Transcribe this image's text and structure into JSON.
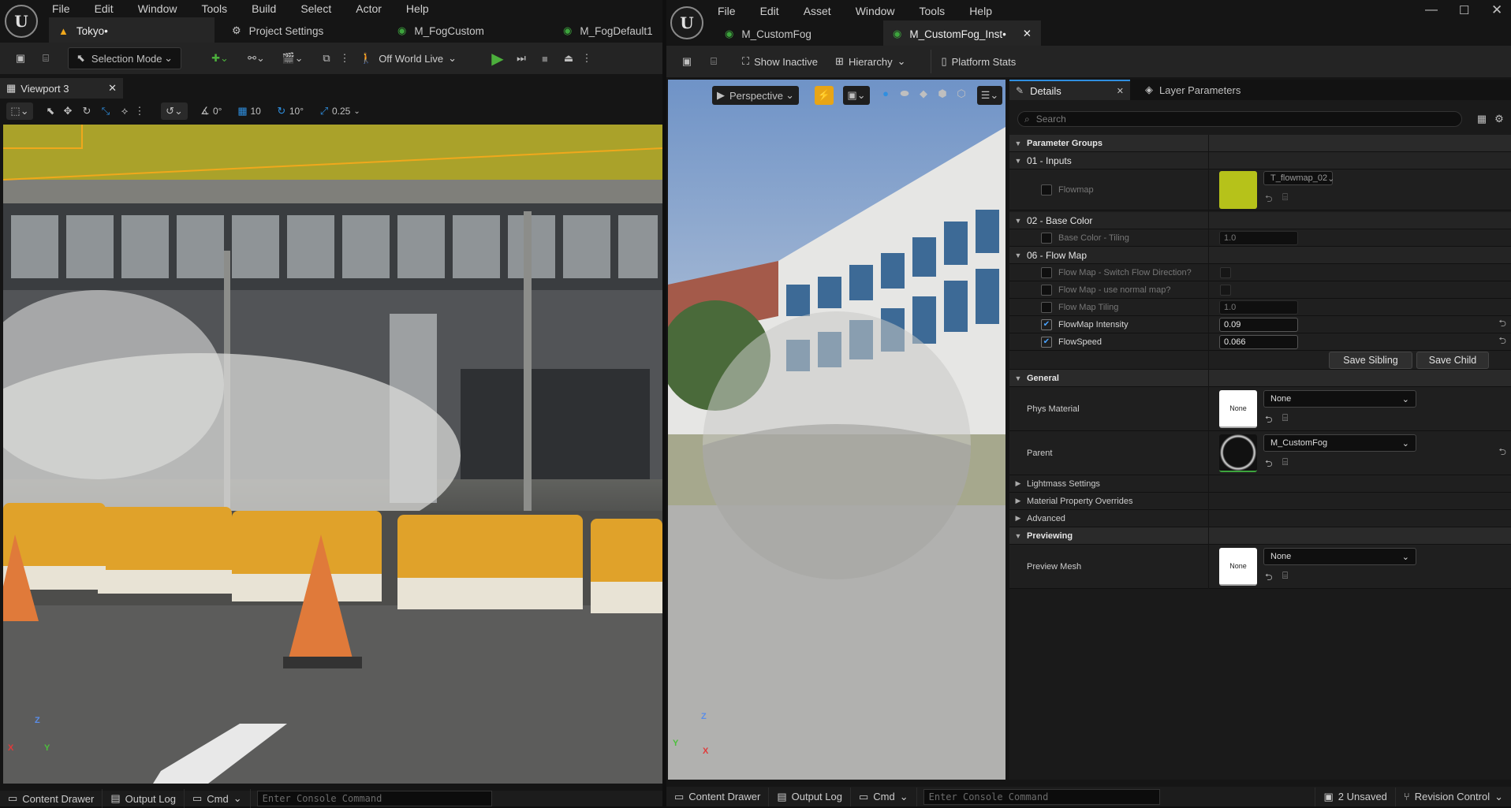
{
  "left_window": {
    "menu": [
      "File",
      "Edit",
      "Window",
      "Tools",
      "Build",
      "Select",
      "Actor",
      "Help"
    ],
    "tabs": [
      {
        "label": "Tokyo•",
        "icon": "level-icon"
      },
      {
        "label": "Project Settings",
        "icon": "gear-icon"
      },
      {
        "label": "M_FogCustom",
        "icon": "material-icon"
      },
      {
        "label": "M_FogDefault1",
        "icon": "material-icon"
      }
    ],
    "toolbar": {
      "selection_mode": "Selection Mode",
      "world": "Off World Live"
    },
    "viewport": {
      "tab": "Viewport 3",
      "snap_angle": "0°",
      "grid": "10",
      "rotation": "10°",
      "scale": "0.25"
    },
    "bottom": {
      "content_drawer": "Content Drawer",
      "output_log": "Output Log",
      "cmd": "Cmd",
      "console_placeholder": "Enter Console Command"
    }
  },
  "right_window": {
    "menu": [
      "File",
      "Edit",
      "Asset",
      "Window",
      "Tools",
      "Help"
    ],
    "tabs": [
      {
        "label": "M_CustomFog",
        "icon": "material-icon"
      },
      {
        "label": "M_CustomFog_Inst•",
        "icon": "material-icon"
      }
    ],
    "toolbar": {
      "show_inactive": "Show Inactive",
      "hierarchy": "Hierarchy",
      "platform_stats": "Platform Stats"
    },
    "preview": {
      "view_mode": "Perspective"
    },
    "details": {
      "tab_details": "Details",
      "tab_layer": "Layer Parameters",
      "search_placeholder": "Search",
      "parameter_groups": "Parameter Groups",
      "inputs": "01 - Inputs",
      "flowmap_label": "Flowmap",
      "flowmap_texture": "T_flowmap_02",
      "base_color": "02 - Base Color",
      "base_tiling_label": "Base Color - Tiling",
      "base_tiling_value": "1.0",
      "flow_map": "06 - Flow Map",
      "switch_dir": "Flow Map - Switch Flow Direction?",
      "normal_map": "Flow Map - use normal map?",
      "tiling_label": "Flow Map Tiling",
      "tiling_value": "1.0",
      "intensity_label": "FlowMap Intensity",
      "intensity_value": "0.09",
      "speed_label": "FlowSpeed",
      "speed_value": "0.066",
      "save_sibling": "Save Sibling",
      "save_child": "Save Child",
      "general": "General",
      "phys_material": "Phys Material",
      "phys_value": "None",
      "none_thumb": "None",
      "parent": "Parent",
      "parent_value": "M_CustomFog",
      "lightmass": "Lightmass Settings",
      "overrides": "Material Property Overrides",
      "advanced": "Advanced",
      "previewing": "Previewing",
      "preview_mesh": "Preview Mesh",
      "preview_value": "None"
    },
    "bottom": {
      "content_drawer": "Content Drawer",
      "output_log": "Output Log",
      "cmd": "Cmd",
      "console_placeholder": "Enter Console Command",
      "unsaved": "2 Unsaved",
      "revision": "Revision Control"
    }
  },
  "colors": {
    "accent_play": "#4caf3c",
    "selection_orange": "#f0a81c",
    "flowmap_yellow": "#b6c21a"
  }
}
